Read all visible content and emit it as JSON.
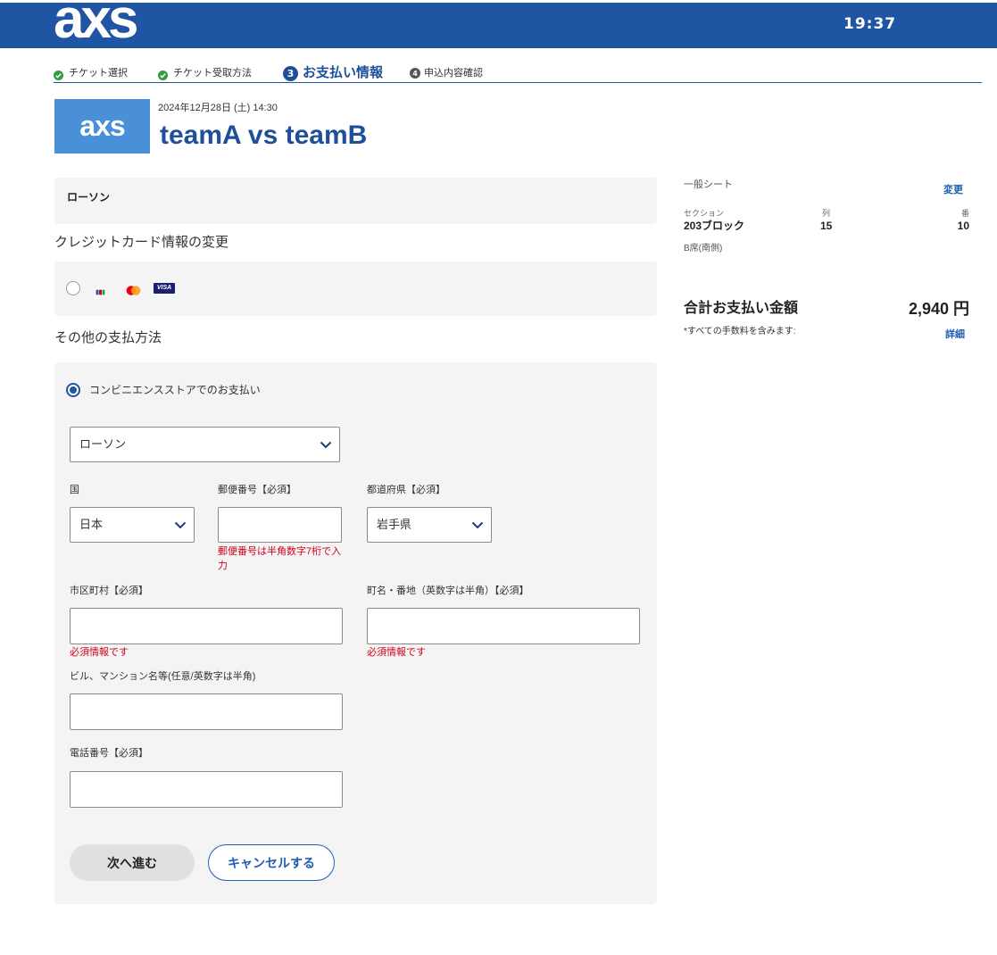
{
  "header": {
    "logo_text": "axs",
    "timer": "19:37"
  },
  "steps": [
    {
      "icon": "check-circle-icon",
      "label": "チケット選択",
      "completed": true
    },
    {
      "icon": "check-circle-icon",
      "label": "チケット受取方法",
      "completed": true
    },
    {
      "number": "3",
      "label": "お支払い情報",
      "active": true
    },
    {
      "number": "4",
      "label": "申込内容確認",
      "active": false
    }
  ],
  "event": {
    "logo_text": "axs",
    "datetime": "2024年12月28日 (土) 14:30",
    "title": "teamA vs teamB"
  },
  "delivery_summary": {
    "label": "ローソン"
  },
  "credit_card": {
    "heading": "クレジットカード情報の変更",
    "selected": false,
    "card_icons": [
      "jcb-icon",
      "mastercard-icon",
      "visa-icon"
    ],
    "visa_text": "VISA"
  },
  "other_payment": {
    "heading": "その他の支払方法",
    "option_label": "コンビニエンスストアでのお支払い",
    "selected": true,
    "store_select": {
      "value": "ローソン"
    },
    "fields": {
      "country": {
        "label": "国",
        "value": "日本"
      },
      "postal_code": {
        "label": "郵便番号【必須】",
        "value": "",
        "error": "郵便番号は半角数字7桁で入力"
      },
      "prefecture": {
        "label": "都道府県【必須】",
        "value": "岩手県"
      },
      "city": {
        "label": "市区町村【必須】",
        "value": "",
        "error": "必須情報です"
      },
      "street": {
        "label": "町名・番地（英数字は半角）【必須】",
        "value": "",
        "error": "必須情報です"
      },
      "building": {
        "label": "ビル、マンション名等(任意/英数字は半角)",
        "value": ""
      },
      "phone": {
        "label": "電話番号【必須】",
        "value": ""
      }
    },
    "buttons": {
      "next": "次へ進む",
      "cancel": "キャンセルする"
    }
  },
  "order_summary": {
    "seat_type": "一般シート",
    "change_link": "変更",
    "section_label": "セクション",
    "row_label": "列",
    "seat_label": "番",
    "section_value": "203ブロック",
    "row_value": "15",
    "seat_value": "10",
    "seat_area": "B席(南側)",
    "total_label": "合計お支払い金額",
    "total_value": "2,940 円",
    "fees_note": "*すべての手数料を含みます:",
    "details_link": "詳細"
  },
  "colors": {
    "brand_blue": "#1f55a3",
    "title_blue": "#1f4f99",
    "logo_box_blue": "#4a90d9",
    "link_blue": "#1f5fb0",
    "error_red": "#d0021b",
    "check_green": "#2e9e3e",
    "panel_grey": "#f4f4f4"
  }
}
